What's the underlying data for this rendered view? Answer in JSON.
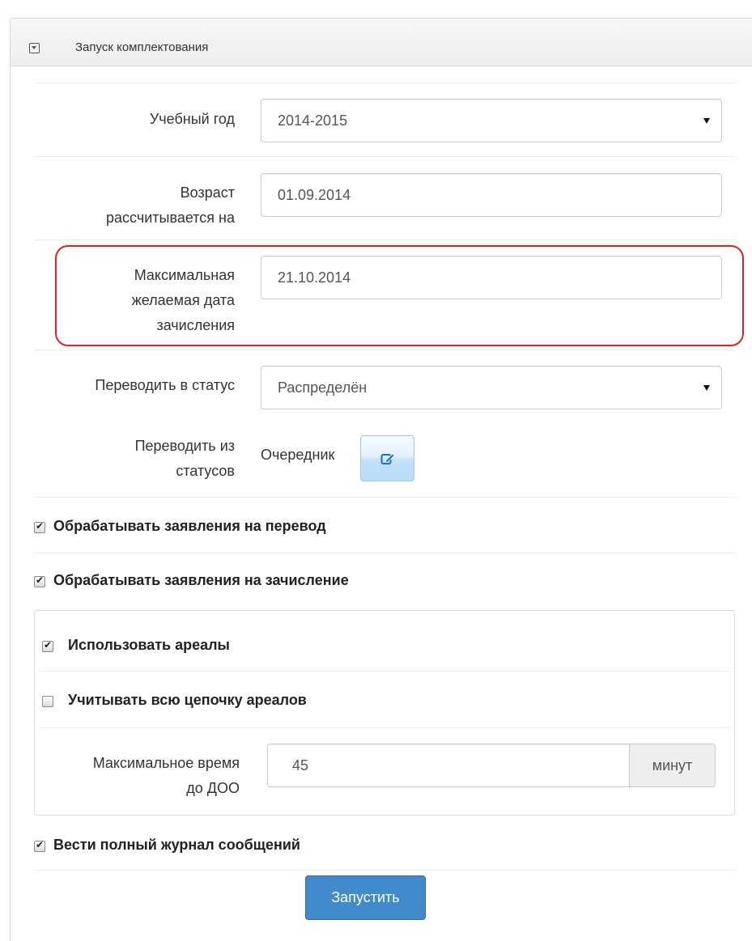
{
  "panel": {
    "title": "Запуск комплектования"
  },
  "form": {
    "academic_year": {
      "label": "Учебный год",
      "value": "2014-2015"
    },
    "age_date": {
      "label_line1": "Возраст",
      "label_line2": "рассчитывается на",
      "value": "01.09.2014"
    },
    "max_enroll_date": {
      "label_line1": "Максимальная",
      "label_line2": "желаемая дата",
      "label_line3": "зачисления",
      "value": "21.10.2014"
    },
    "target_status": {
      "label": "Переводить в статус",
      "value": "Распределён"
    },
    "from_statuses": {
      "label_line1": "Переводить из",
      "label_line2": "статусов",
      "value": "Очередник"
    },
    "process_transfer": {
      "label": "Обрабатывать заявления на перевод",
      "checked": true
    },
    "process_enroll": {
      "label": "Обрабатывать заявления на зачисление",
      "checked": true
    },
    "use_areas": {
      "label": "Использовать ареалы",
      "checked": true
    },
    "area_chain": {
      "label": "Учитывать всю цепочку ареалов",
      "checked": false
    },
    "max_time": {
      "label_line1": "Максимальное время",
      "label_line2": "до ДОО",
      "value": "45",
      "unit": "минут"
    },
    "full_log": {
      "label": "Вести полный журнал сообщений",
      "checked": true
    },
    "submit_label": "Запустить"
  },
  "colors": {
    "highlight": "#e0202a",
    "primary": "#428bca"
  }
}
